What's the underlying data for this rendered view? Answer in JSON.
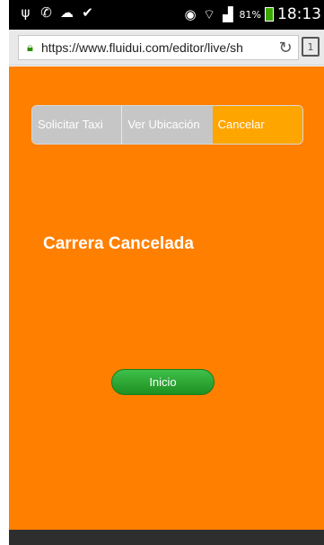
{
  "status_bar": {
    "icons": [
      "usb-icon",
      "whatsapp-icon",
      "cloud-icon",
      "check-icon"
    ],
    "right_icons": [
      "eye-icon",
      "wifi-icon",
      "signal-icon"
    ],
    "battery": "81%",
    "time": "18:13"
  },
  "browser": {
    "url": "https://www.fluidui.com/editor/live/sh",
    "tabs_count": "1"
  },
  "nav": {
    "tab1": "Solicitar  Taxi",
    "tab2": "Ver Ubicación",
    "tab3": "Cancelar"
  },
  "main": {
    "title": "Carrera Cancelada",
    "button": "Inicio"
  },
  "colors": {
    "background": "#ff7f00",
    "active_tab": "#ffa500",
    "inactive_tab": "#c6c6c6",
    "button": "#2aa835"
  }
}
